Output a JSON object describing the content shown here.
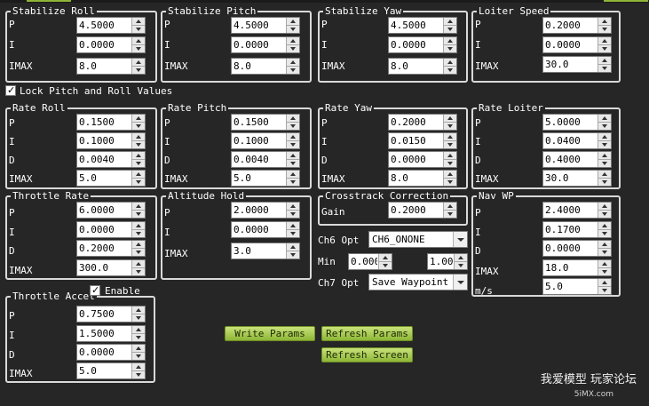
{
  "groups": {
    "stabilize_roll": {
      "title": "Stabilize Roll",
      "rows": [
        {
          "label": "P",
          "value": "4.5000"
        },
        {
          "label": "I",
          "value": "0.0000"
        },
        {
          "label": "IMAX",
          "value": "8.0"
        }
      ]
    },
    "stabilize_pitch": {
      "title": "Stabilize Pitch",
      "rows": [
        {
          "label": "P",
          "value": "4.5000"
        },
        {
          "label": "I",
          "value": "0.0000"
        },
        {
          "label": "IMAX",
          "value": "8.0"
        }
      ]
    },
    "stabilize_yaw": {
      "title": "Stabilize Yaw",
      "rows": [
        {
          "label": "P",
          "value": "4.5000"
        },
        {
          "label": "I",
          "value": "0.0000"
        },
        {
          "label": "IMAX",
          "value": "8.0"
        }
      ]
    },
    "loiter_speed": {
      "title": "Loiter Speed",
      "rows": [
        {
          "label": "P",
          "value": "0.2000"
        },
        {
          "label": "I",
          "value": "0.0000"
        },
        {
          "label": "IMAX",
          "value": "30.0"
        }
      ]
    },
    "rate_roll": {
      "title": "Rate Roll",
      "rows": [
        {
          "label": "P",
          "value": "0.1500"
        },
        {
          "label": "I",
          "value": "0.1000"
        },
        {
          "label": "D",
          "value": "0.0040"
        },
        {
          "label": "IMAX",
          "value": "5.0"
        }
      ]
    },
    "rate_pitch": {
      "title": "Rate Pitch",
      "rows": [
        {
          "label": "P",
          "value": "0.1500"
        },
        {
          "label": "I",
          "value": "0.1000"
        },
        {
          "label": "D",
          "value": "0.0040"
        },
        {
          "label": "IMAX",
          "value": "5.0"
        }
      ]
    },
    "rate_yaw": {
      "title": "Rate Yaw",
      "rows": [
        {
          "label": "P",
          "value": "0.2000"
        },
        {
          "label": "I",
          "value": "0.0150"
        },
        {
          "label": "D",
          "value": "0.0000"
        },
        {
          "label": "IMAX",
          "value": "8.0"
        }
      ]
    },
    "rate_loiter": {
      "title": "Rate Loiter",
      "rows": [
        {
          "label": "P",
          "value": "5.0000"
        },
        {
          "label": "I",
          "value": "0.0400"
        },
        {
          "label": "D",
          "value": "0.4000"
        },
        {
          "label": "IMAX",
          "value": "30.0"
        }
      ]
    },
    "throttle_rate": {
      "title": "Throttle Rate",
      "rows": [
        {
          "label": "P",
          "value": "6.0000"
        },
        {
          "label": "I",
          "value": "0.0000"
        },
        {
          "label": "D",
          "value": "0.2000"
        },
        {
          "label": "IMAX",
          "value": "300.0"
        }
      ]
    },
    "altitude_hold": {
      "title": "Altitude Hold",
      "rows": [
        {
          "label": "P",
          "value": "2.0000"
        },
        {
          "label": "I",
          "value": "0.0000"
        },
        {
          "label": "IMAX",
          "value": "3.0"
        }
      ]
    },
    "crosstrack": {
      "title": "Crosstrack Correction",
      "rows": [
        {
          "label": "Gain",
          "value": "0.2000"
        }
      ]
    },
    "nav_wp": {
      "title": "Nav WP",
      "rows": [
        {
          "label": "P",
          "value": "2.4000"
        },
        {
          "label": "I",
          "value": "0.1700"
        },
        {
          "label": "D",
          "value": "0.0000"
        },
        {
          "label": "IMAX",
          "value": "18.0"
        },
        {
          "label": "m/s",
          "value": "5.0"
        }
      ]
    },
    "throttle_accel": {
      "title": "Throttle Accel",
      "enable_label": "Enable",
      "rows": [
        {
          "label": "P",
          "value": "0.7500"
        },
        {
          "label": "I",
          "value": "1.5000"
        },
        {
          "label": "D",
          "value": "0.0000"
        },
        {
          "label": "IMAX",
          "value": "5.0"
        }
      ]
    }
  },
  "lock_pitch_roll_label": "Lock Pitch and Roll Values",
  "ch6": {
    "label": "Ch6 Opt",
    "value": "CH6_ONONE"
  },
  "min": {
    "label": "Min",
    "min_value": "0.000",
    "max_value": "1.000"
  },
  "ch7": {
    "label": "Ch7 Opt",
    "value": "Save Waypoint"
  },
  "buttons": {
    "write_params": "Write Params",
    "refresh_params": "Refresh Params",
    "refresh_screen": "Refresh Screen"
  },
  "watermark": {
    "line1": "我爱模型 玩家论坛",
    "line2": "5iMX.com"
  },
  "colors": {
    "background": "#262626",
    "button_green": "#a8cc4f",
    "border": "#d9d9d9"
  }
}
